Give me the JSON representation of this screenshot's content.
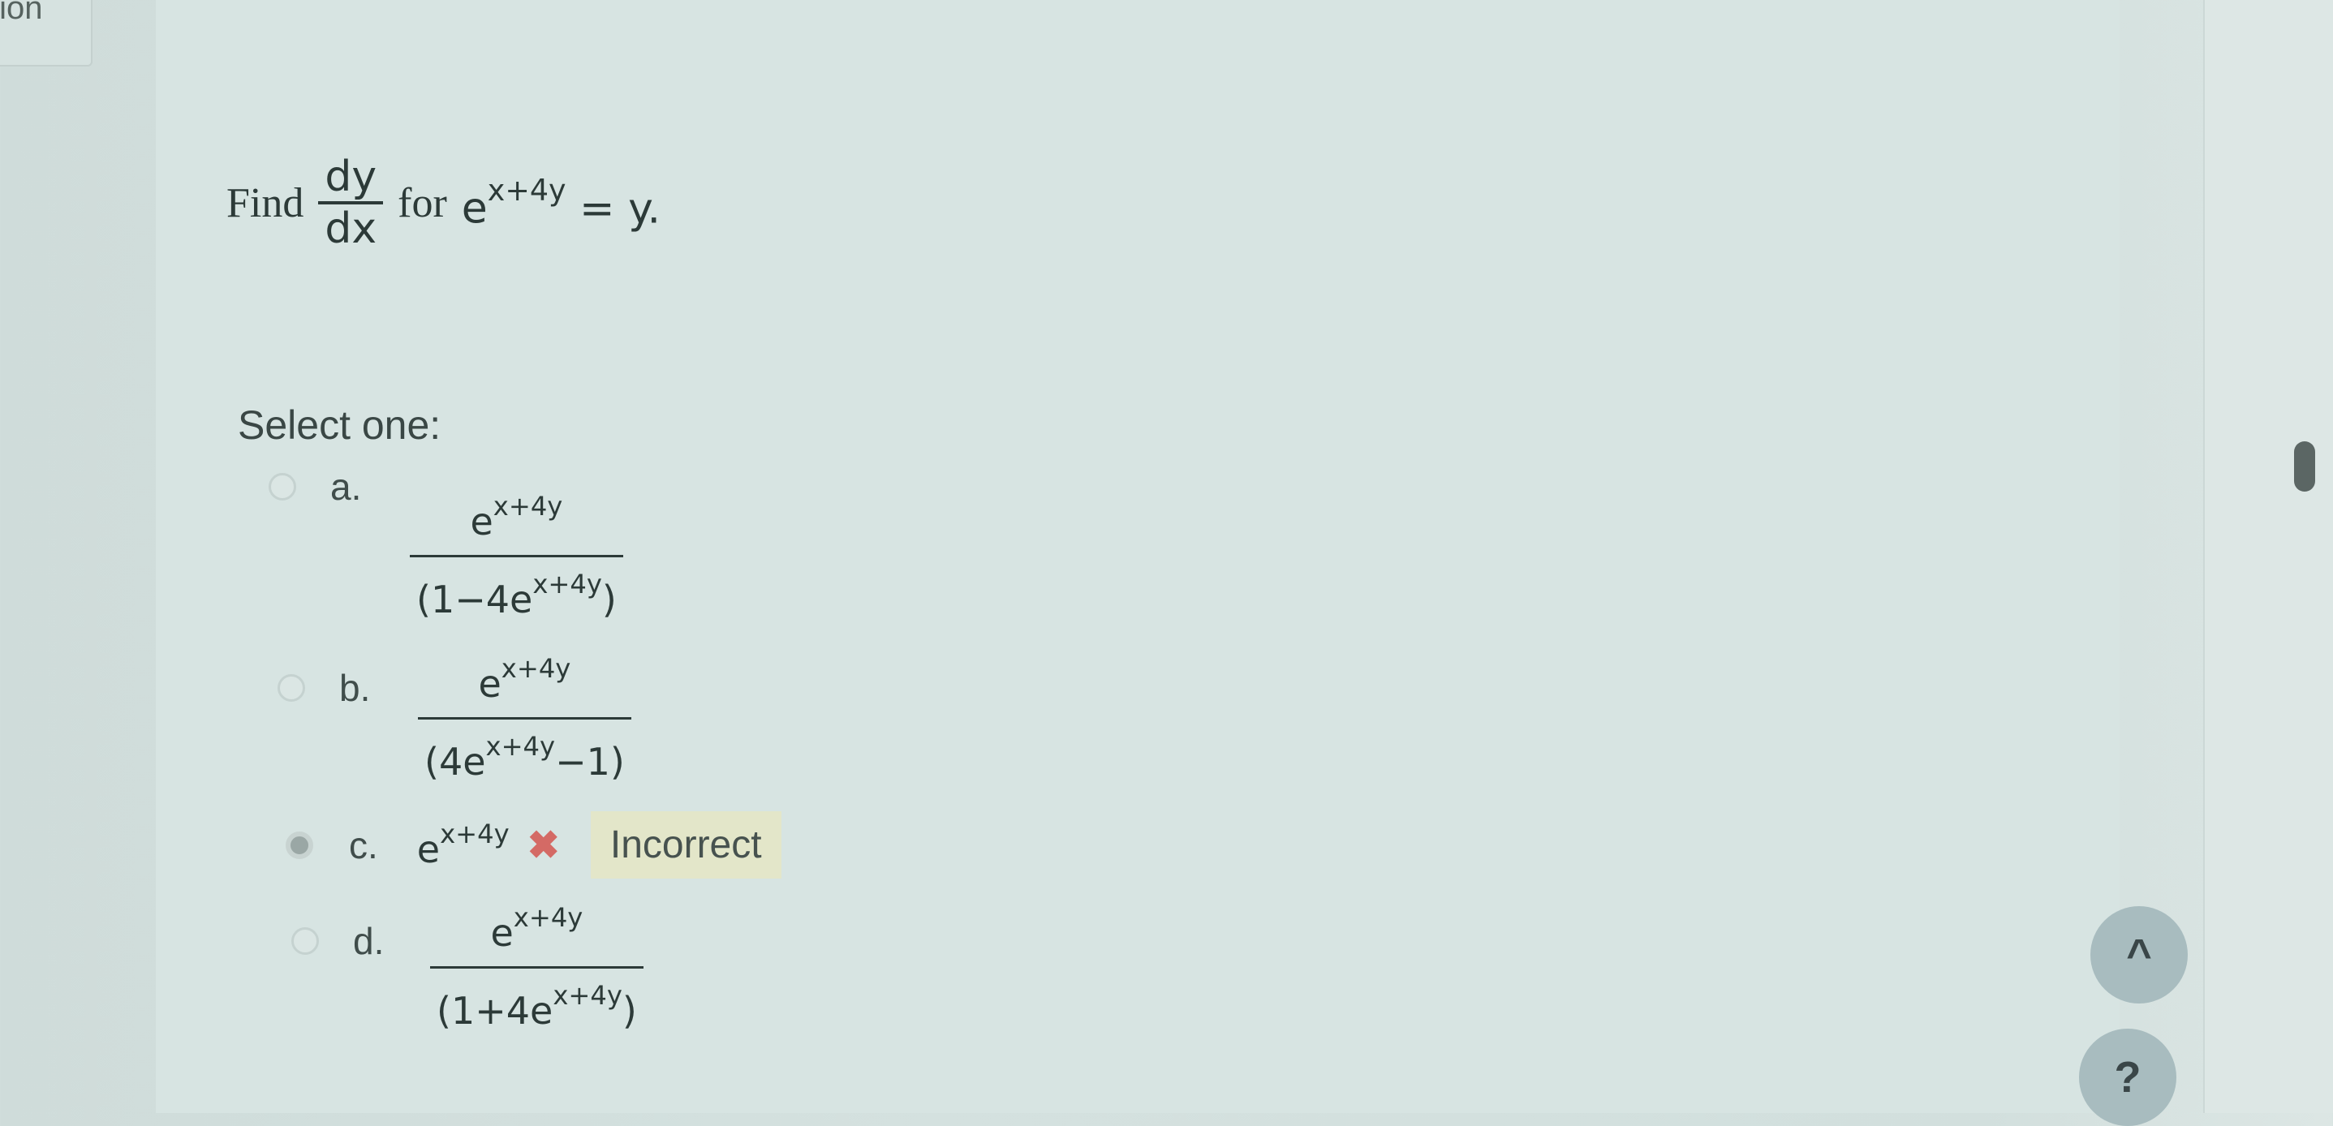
{
  "nav": {
    "tab_label": "tion"
  },
  "question": {
    "find": "Find",
    "dy": "dy",
    "dx": "dx",
    "for": "for",
    "base": "e",
    "exponent": "x+4y",
    "rhs": "= y."
  },
  "select_label": "Select one:",
  "options": [
    {
      "letter": "a.",
      "num_base": "e",
      "num_exp": "x+4y",
      "den_pre": "(1−4e",
      "den_exp": "x+4y",
      "den_post": ")",
      "selected": false
    },
    {
      "letter": "b.",
      "num_base": "e",
      "num_exp": "x+4y",
      "den_pre": "(4e",
      "den_exp": "x+4y",
      "den_post": "−1)",
      "selected": false
    },
    {
      "letter": "c.",
      "base": "e",
      "exp": "x+4y",
      "selected": true,
      "feedback": "Incorrect",
      "feedback_icon": "x-mark-icon"
    },
    {
      "letter": "d.",
      "num_base": "e",
      "num_exp": "x+4y",
      "den_pre": "(1+4e",
      "den_exp": "x+4y",
      "den_post": ")",
      "selected": false
    }
  ],
  "buttons": {
    "up_icon": "^",
    "help_label": "?"
  },
  "colors": {
    "incorrect_mark": "#d46a65",
    "feedback_bg": "#e3e6c9",
    "background": "#d4e1df"
  }
}
